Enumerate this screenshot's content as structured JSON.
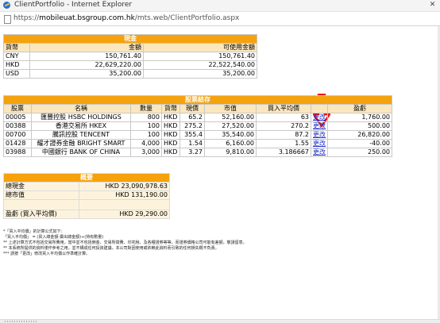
{
  "window": {
    "title": "ClientPortfolio - Internet Explorer",
    "close_glyph": "✕",
    "url_prefix": "https://",
    "url_domain": "mobileuat.bsgroup.com.hk",
    "url_path": "/mts.web/ClientPortfolio.aspx"
  },
  "cash": {
    "title": "現金",
    "headers": [
      "貨幣",
      "金額",
      "可使用金額"
    ],
    "rows": [
      {
        "currency": "CNY",
        "amount": "150,761.40",
        "available": "150,761.40"
      },
      {
        "currency": "HKD",
        "amount": "22,629,220.00",
        "available": "22,522,540.00"
      },
      {
        "currency": "USD",
        "amount": "35,200.00",
        "available": "35,200.00"
      }
    ]
  },
  "stocks": {
    "title": "股票結存",
    "headers": [
      "股票",
      "名稱",
      "數量",
      "貨幣",
      "現價",
      "市值",
      "買入平均價",
      "",
      "盈虧"
    ],
    "rows": [
      {
        "code": "00005",
        "name": "匯豐控股 HSBC HOLDINGS",
        "qty": "800",
        "currency": "HKD",
        "price": "65.2",
        "value": "52,160.00",
        "avg": "63",
        "action": "更改",
        "pnl": "1,760.00"
      },
      {
        "code": "00388",
        "name": "香港交易所 HKEX",
        "qty": "100",
        "currency": "HKD",
        "price": "275.2",
        "value": "27,520.00",
        "avg": "270.2",
        "action": "更改",
        "pnl": "500.00"
      },
      {
        "code": "00700",
        "name": "騰訊控股 TENCENT",
        "qty": "100",
        "currency": "HKD",
        "price": "355.4",
        "value": "35,540.00",
        "avg": "87.2",
        "action": "更改",
        "pnl": "26,820.00"
      },
      {
        "code": "01428",
        "name": "耀才證券金融 BRIGHT SMART",
        "qty": "4,000",
        "currency": "HKD",
        "price": "1.54",
        "value": "6,160.00",
        "avg": "1.55",
        "action": "更改",
        "pnl": "-40.00"
      },
      {
        "code": "03988",
        "name": "中國銀行 BANK OF CHINA",
        "qty": "3,000",
        "currency": "HKD",
        "price": "3.27",
        "value": "9,810.00",
        "avg": "3.186667",
        "action": "更改",
        "pnl": "250.00"
      }
    ]
  },
  "summary": {
    "title": "概要",
    "rows": [
      {
        "label": "總現金",
        "value": "HKD 23,090,978.63"
      },
      {
        "label": "總市值",
        "value": "HKD 131,190.00"
      },
      {
        "label": "",
        "value": ""
      },
      {
        "label": "盈虧 (買入平均價)",
        "value": "HKD 29,290.00"
      }
    ]
  },
  "notes": [
    "*「買入平均價」的計算公式如下：",
    "「買入平均價」 = (買入總金額-賣出總金額)÷(持有數量)",
    "** 上述計算方式不包括交易所費用，當中並不包括佣金、交易所徵費、印花稅、及各種證券等等，而證券價格公司可能有差額，敬請留意。",
    "** 本系統所提供的資料僅作參考之用，並不構成任何投資建議，本公司對因使用或依賴此資料而引致的任何損失概不負責。",
    "*** 請按「更改」修改買入平均價以作準確計算。"
  ],
  "colors": {
    "header": "#f5a20c",
    "subheader": "#fbe7bd",
    "arrow": "#e8141c",
    "link": "#2233cc"
  }
}
